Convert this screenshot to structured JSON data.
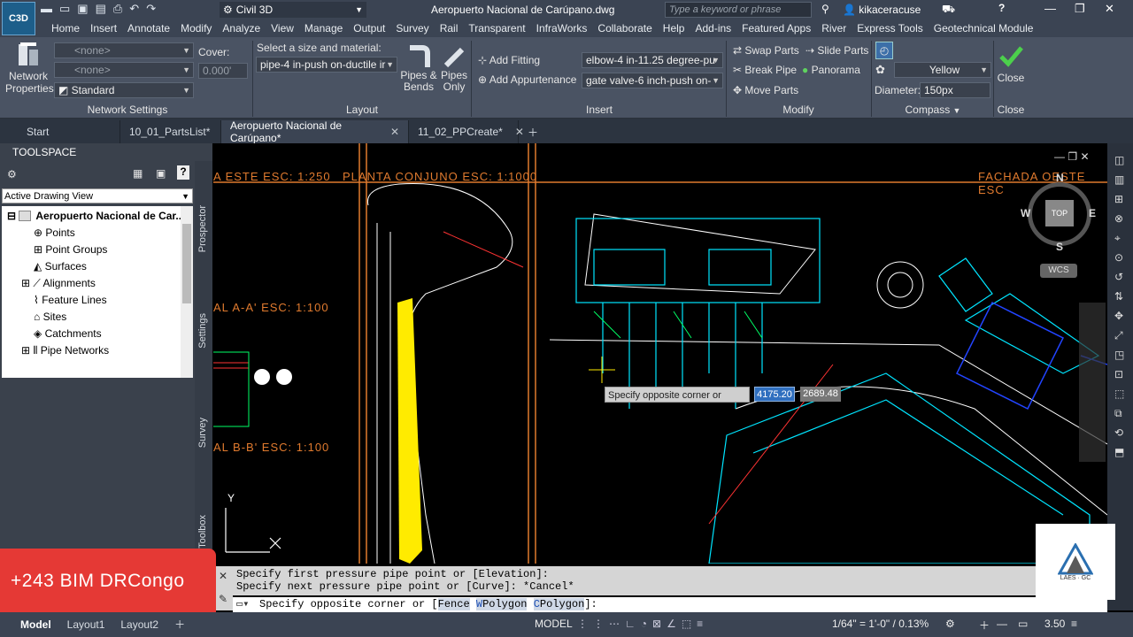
{
  "app": {
    "logo": "C3D",
    "workspace": "Civil 3D",
    "document_title": "Aeropuerto Nacional de Carúpano.dwg",
    "search_placeholder": "Type a keyword or phrase",
    "user": "kikaceracuse"
  },
  "menu": [
    "Home",
    "Insert",
    "Annotate",
    "Modify",
    "Analyze",
    "View",
    "Manage",
    "Output",
    "Survey",
    "Rail",
    "Transparent",
    "InfraWorks",
    "Collaborate",
    "Help",
    "Add-ins",
    "Featured Apps",
    "River",
    "Express Tools",
    "Geotechnical Module"
  ],
  "ribbon": {
    "network_properties_label": "Network Properties",
    "network_settings": {
      "title": "Network Settings",
      "combo1": "<none>",
      "combo2": "<none>",
      "combo3": "Standard",
      "cover_label": "Cover:",
      "cover_value": "0.000'"
    },
    "layout": {
      "title": "Layout",
      "size_label": "Select a size and material:",
      "size_value": "pipe-4 in-push on-ductile ir",
      "pipes_bends": "Pipes & Bends",
      "pipes_only": "Pipes Only"
    },
    "insert": {
      "title": "Insert",
      "add_fitting": "Add Fitting",
      "add_appurtenance": "Add Appurtenance",
      "fitting_value": "elbow-4 in-11.25 degree-pu",
      "appurtenance_value": "gate valve-6 inch-push on-"
    },
    "modify": {
      "title": "Modify",
      "swap_parts": "Swap Parts",
      "slide_parts": "Slide Parts",
      "break_pipe": "Break Pipe",
      "panorama": "Panorama",
      "move_parts": "Move Parts"
    },
    "compass": {
      "title": "Compass",
      "color": "Yellow",
      "diameter_label": "Diameter:",
      "diameter_value": "150px"
    },
    "close": {
      "label": "Close",
      "title": "Close"
    }
  },
  "doc_tabs": [
    {
      "label": "Start"
    },
    {
      "label": "10_01_PartsList*"
    },
    {
      "label": "Aeropuerto Nacional de Carúpano*"
    },
    {
      "label": "11_02_PPCreate*"
    }
  ],
  "toolspace": {
    "title": "TOOLSPACE",
    "view": "Active Drawing View",
    "tree": [
      "Aeropuerto Nacional de Car...",
      "Points",
      "Point Groups",
      "Surfaces",
      "Alignments",
      "Feature Lines",
      "Sites",
      "Catchments",
      "Pipe Networks"
    ],
    "side_tabs": [
      "Prospector",
      "Settings",
      "Survey",
      "Toolbox"
    ]
  },
  "drawing": {
    "labels": [
      "A ESTE ESC: 1:250",
      "PLANTA CONJUNO ESC: 1:1000",
      "FACHADA OESTE ESC",
      "AL A-A' ESC: 1:100",
      "AL B-B' ESC: 1:100"
    ],
    "viewcube": {
      "top": "TOP",
      "n": "N",
      "s": "S",
      "e": "E",
      "w": "W",
      "wcs": "WCS"
    },
    "tooltip": "Specify opposite corner or",
    "coord_x": "4175.20",
    "coord_y": "2689.48",
    "ucs_y": "Y"
  },
  "command": {
    "history1": "Specify first pressure pipe point or [Elevation]:",
    "history2": "Specify next pressure pipe point or [Curve]: *Cancel*",
    "prompt": "Specify opposite corner or [",
    "opt1": "Fence",
    "opt2_key": "W",
    "opt2": "Polygon",
    "opt3_key": "C",
    "opt3": "Polygon",
    "end": "]:"
  },
  "banner": "+243 BIM DRCongo",
  "watermark": "LAES · GC",
  "status": {
    "layouts": [
      "Model",
      "Layout1",
      "Layout2"
    ],
    "model": "MODEL",
    "scale": "1/64\" = 1'-0\" / 0.13%",
    "value": "3.50"
  },
  "colors": {
    "accent": "#e53935",
    "ribbon": "#4a5363",
    "titlebar": "#3b4453"
  }
}
